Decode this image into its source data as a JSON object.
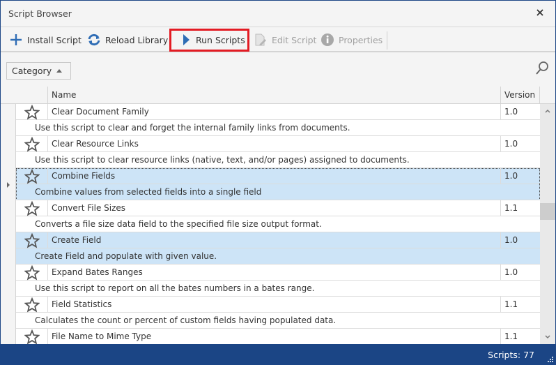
{
  "window": {
    "title": "Script Browser",
    "close_icon": "close-icon"
  },
  "toolbar": {
    "buttons": [
      {
        "label": "Install Script",
        "icon": "plus-icon",
        "enabled": true
      },
      {
        "label": "Reload Library",
        "icon": "refresh-icon",
        "enabled": true
      },
      {
        "label": "Run Scripts",
        "icon": "play-icon",
        "enabled": true,
        "highlighted": true
      },
      {
        "label": "Edit Script",
        "icon": "edit-document-icon",
        "enabled": false
      },
      {
        "label": "Properties",
        "icon": "info-icon",
        "enabled": false
      }
    ],
    "highlight_color": "#e31b23"
  },
  "filter": {
    "group_by_label": "Category",
    "search_icon": "search-icon"
  },
  "grid": {
    "columns": [
      "",
      "Name",
      "Version"
    ],
    "rows": [
      {
        "name": "Clear Document Family",
        "version": "1.0",
        "description": "Use this script to clear and forget the internal family links from documents.",
        "selected": false
      },
      {
        "name": "Clear Resource Links",
        "version": "1.0",
        "description": "Use this script to clear resource links (native, text, and/or pages) assigned to documents.",
        "selected": false
      },
      {
        "name": "Combine Fields",
        "version": "1.0",
        "description": "Combine values from selected fields into a single field",
        "selected": true,
        "focused": true
      },
      {
        "name": "Convert File Sizes",
        "version": "1.1",
        "description": "Converts a file size data field to the specified file size output format.",
        "selected": false
      },
      {
        "name": "Create Field",
        "version": "1.0",
        "description": "Create Field and populate with given value.",
        "selected": true
      },
      {
        "name": "Expand Bates Ranges",
        "version": "1.0",
        "description": "Use this script to report on all the bates numbers in a bates range.",
        "selected": false
      },
      {
        "name": "Field Statistics",
        "version": "1.1",
        "description": "Calculates the count or percent of custom fields having populated data.",
        "selected": false
      },
      {
        "name": "File Name to Mime Type",
        "version": "1.1",
        "description": "",
        "selected": false
      }
    ]
  },
  "status": {
    "text": "Scripts: 77"
  },
  "colors": {
    "accent": "#1b4585",
    "selection": "#cde4f7"
  }
}
